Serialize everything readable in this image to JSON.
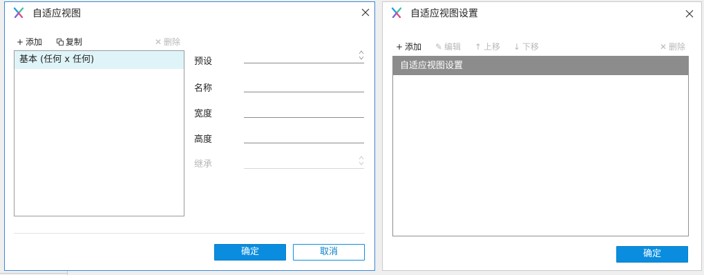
{
  "dialog1": {
    "title": "自适应视图",
    "toolbar": {
      "add": "添加",
      "copy": "复制",
      "delete": "删除"
    },
    "views": [
      "基本 (任何 x 任何)"
    ],
    "fields": {
      "preset": "预设",
      "name": "名称",
      "width": "宽度",
      "height": "高度",
      "inherit": "继承"
    },
    "ok": "确定",
    "cancel": "取消"
  },
  "dialog2": {
    "title": "自适应视图设置",
    "toolbar": {
      "add": "添加",
      "edit": "编辑",
      "move_up": "上移",
      "move_down": "下移",
      "delete": "删除"
    },
    "grid_header": "自适应视图设置",
    "ok": "确定"
  },
  "colors": {
    "accent": "#0a8ddf",
    "selected_row": "#dff4f8",
    "header_gray": "#8c8c8c",
    "disabled": "#b8b8b8"
  }
}
